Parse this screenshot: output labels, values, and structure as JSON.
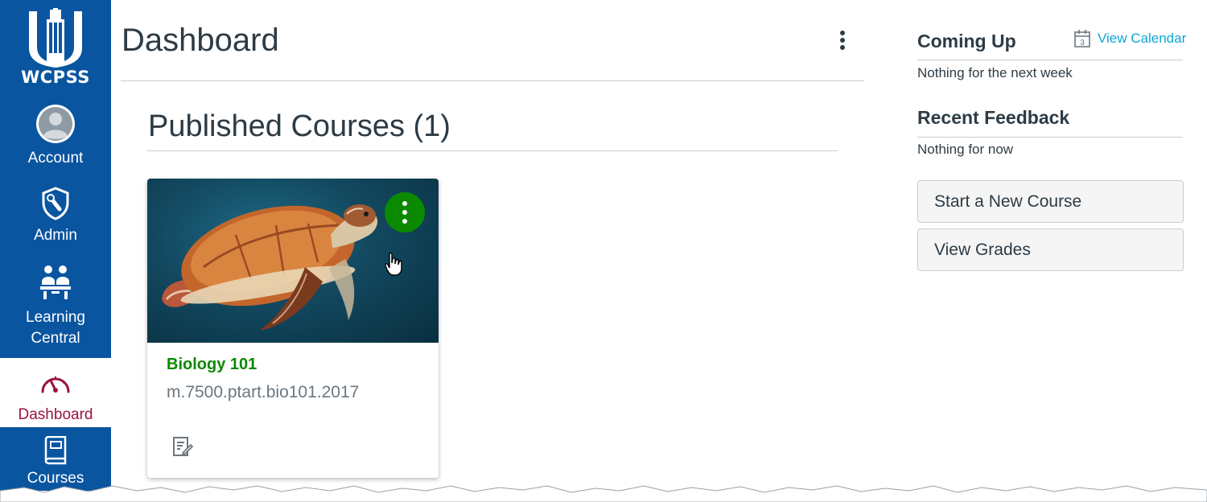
{
  "colors": {
    "nav_bg": "#0a55a0",
    "nav_active_text": "#98143f",
    "course_green": "#0b8a00",
    "link_blue": "#0ea5d8",
    "text": "#2d3b45"
  },
  "nav": {
    "logo_text": "WCPSS",
    "items": [
      {
        "label": "Account",
        "icon": "avatar-icon"
      },
      {
        "label": "Admin",
        "icon": "shield-wrench-icon"
      },
      {
        "label": "Learning Central",
        "icon": "classroom-icon"
      },
      {
        "label": "Dashboard",
        "icon": "speedometer-icon",
        "active": true
      },
      {
        "label": "Courses",
        "icon": "book-icon"
      }
    ]
  },
  "main": {
    "title": "Dashboard",
    "section_title": "Published Courses (1)",
    "course_card": {
      "title": "Biology 101",
      "code": "m.7500.ptart.bio101.2017",
      "image": "sea-turtle-image",
      "menu_icon": "vertical-dots-icon",
      "footer_icon": "assignments-icon"
    }
  },
  "sidebar": {
    "coming_up": {
      "heading": "Coming Up",
      "link": "View Calendar",
      "calendar_day": "3",
      "empty": "Nothing for the next week"
    },
    "recent_feedback": {
      "heading": "Recent Feedback",
      "empty": "Nothing for now"
    },
    "buttons": {
      "start_course": "Start a New Course",
      "view_grades": "View Grades"
    }
  }
}
